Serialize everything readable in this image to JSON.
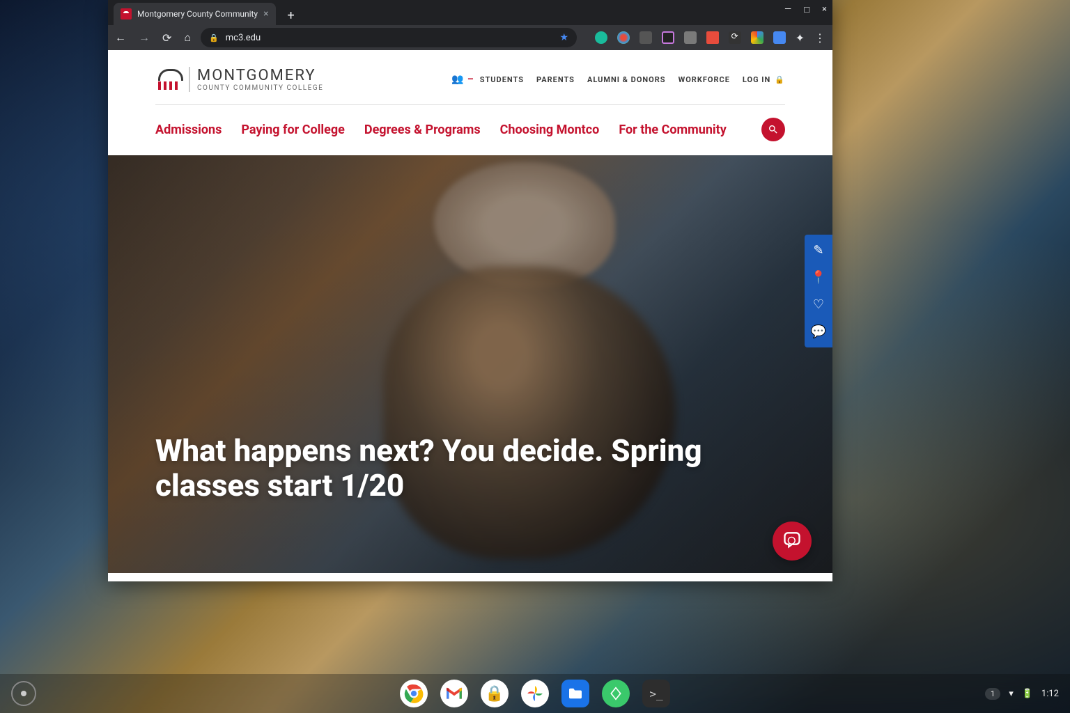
{
  "browser": {
    "tab_title": "Montgomery County Community",
    "url": "mc3.edu"
  },
  "logo": {
    "line1": "MONTGOMERY",
    "line2": "COUNTY COMMUNITY COLLEGE"
  },
  "utility_nav": {
    "students": "STUDENTS",
    "parents": "PARENTS",
    "alumni": "ALUMNI & DONORS",
    "workforce": "WORKFORCE",
    "login": "LOG IN"
  },
  "main_nav": {
    "admissions": "Admissions",
    "paying": "Paying for College",
    "degrees": "Degrees & Programs",
    "choosing": "Choosing Montco",
    "community": "For the Community"
  },
  "hero": {
    "title": "What happens next? You decide. Spring classes start 1/20"
  },
  "status": {
    "notif": "1",
    "time": "1:12"
  }
}
